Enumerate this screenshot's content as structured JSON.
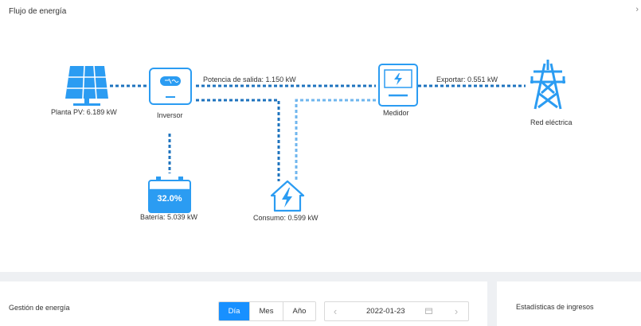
{
  "flow": {
    "title": "Flujo de energía",
    "pv_label": "Planta PV: 6.189 kW",
    "inverter_label": "Inversor",
    "output_power_label": "Potencia de salida: 1.150 kW",
    "meter_label": "Medidor",
    "export_label": "Exportar: 0.551 kW",
    "grid_label": "Red eléctrica",
    "battery_percent": "32.0%",
    "battery_level": 0.32,
    "battery_label": "Batería: 5.039 kW",
    "consumption_label": "Consumo: 0.599 kW"
  },
  "energy_management": {
    "title": "Gestión de energía",
    "tabs": [
      "Día",
      "Mes",
      "Año"
    ],
    "active_tab": "Día",
    "date": "2022-01-23"
  },
  "income": {
    "title": "Estadísticas de ingresos"
  },
  "colors": {
    "accent": "#1890ff",
    "flow_dark": "#1e73be",
    "flow_light": "#6fb6ee",
    "icon_blue": "#2b9cf2"
  }
}
